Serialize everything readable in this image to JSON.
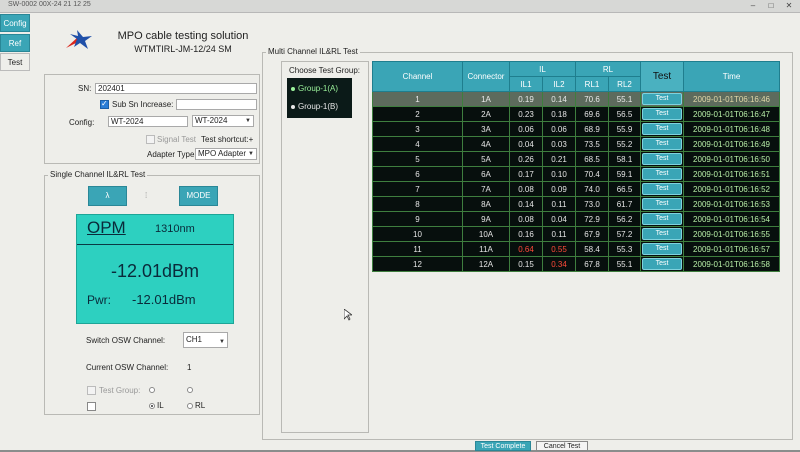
{
  "window": {
    "title": "SW-0002 00X-24 21 12 25"
  },
  "sidebar": {
    "tabs": [
      {
        "label": "Config"
      },
      {
        "label": "Ref"
      },
      {
        "label": "Test"
      }
    ]
  },
  "header": {
    "title": "MPO cable testing solution",
    "subtitle": "WTMTIRL-JM-12/24 SM"
  },
  "config": {
    "sn_label": "SN:",
    "sn_value": "202401",
    "sub_sn_label": "Sub Sn Increase:",
    "config_label": "Config:",
    "config_value1": "WT-2024",
    "config_value2": "WT-2024",
    "signal_test_label": "Signal Test",
    "test_shortcut_label": "Test shortcut:+",
    "adapter_type_label": "Adapter Type",
    "adapter_type_value": "MPO Adapter"
  },
  "single_channel": {
    "title": "Single Channel IL&RL Test",
    "lambda_button": "λ",
    "mode_button": "MODE",
    "opm_title": "OPM",
    "wavelength": "1310nm",
    "power_main": "-12.01dBm",
    "pwr_label": "Pwr:",
    "pwr_value": "-12.01dBm",
    "switch_osw_label": "Switch OSW Channel:",
    "switch_osw_value": "CH1",
    "current_osw_label": "Current OSW Channel:",
    "current_osw_value": "1",
    "test_group_label": "Test Group:",
    "il_label": "IL",
    "rl_label": "RL"
  },
  "multi_channel": {
    "title": "Multi Channel IL&RL Test",
    "choose_group_label": "Choose Test Group:",
    "groups": [
      {
        "label": "Group-1(A)"
      },
      {
        "label": "Group-1(B)"
      }
    ],
    "headers": {
      "channel": "Channel",
      "connector": "Connector",
      "il": "IL",
      "rl": "RL",
      "test": "Test",
      "time": "Time",
      "il1": "IL1",
      "il2": "IL2",
      "rl1": "RL1",
      "rl2": "RL2"
    },
    "rows": [
      {
        "channel": "1",
        "connector": "1A",
        "il1": "0.19",
        "il2": "0.14",
        "rl1": "70.6",
        "rl2": "55.1",
        "test": "Test",
        "time": "2009-01-01T06:16:46"
      },
      {
        "channel": "2",
        "connector": "2A",
        "il1": "0.23",
        "il2": "0.18",
        "rl1": "69.6",
        "rl2": "56.5",
        "test": "Test",
        "time": "2009-01-01T06:16:47"
      },
      {
        "channel": "3",
        "connector": "3A",
        "il1": "0.06",
        "il2": "0.06",
        "rl1": "68.9",
        "rl2": "55.9",
        "test": "Test",
        "time": "2009-01-01T06:16:48"
      },
      {
        "channel": "4",
        "connector": "4A",
        "il1": "0.04",
        "il2": "0.03",
        "rl1": "73.5",
        "rl2": "55.2",
        "test": "Test",
        "time": "2009-01-01T06:16:49"
      },
      {
        "channel": "5",
        "connector": "5A",
        "il1": "0.26",
        "il2": "0.21",
        "rl1": "68.5",
        "rl2": "58.1",
        "test": "Test",
        "time": "2009-01-01T06:16:50"
      },
      {
        "channel": "6",
        "connector": "6A",
        "il1": "0.17",
        "il2": "0.10",
        "rl1": "70.4",
        "rl2": "59.1",
        "test": "Test",
        "time": "2009-01-01T06:16:51"
      },
      {
        "channel": "7",
        "connector": "7A",
        "il1": "0.08",
        "il2": "0.09",
        "rl1": "74.0",
        "rl2": "66.5",
        "test": "Test",
        "time": "2009-01-01T06:16:52"
      },
      {
        "channel": "8",
        "connector": "8A",
        "il1": "0.14",
        "il2": "0.11",
        "rl1": "73.0",
        "rl2": "61.7",
        "test": "Test",
        "time": "2009-01-01T06:16:53"
      },
      {
        "channel": "9",
        "connector": "9A",
        "il1": "0.08",
        "il2": "0.04",
        "rl1": "72.9",
        "rl2": "56.2",
        "test": "Test",
        "time": "2009-01-01T06:16:54"
      },
      {
        "channel": "10",
        "connector": "10A",
        "il1": "0.16",
        "il2": "0.11",
        "rl1": "67.9",
        "rl2": "57.2",
        "test": "Test",
        "time": "2009-01-01T06:16:55"
      },
      {
        "channel": "11",
        "connector": "11A",
        "il1": "0.64",
        "il2": "0.55",
        "rl1": "58.4",
        "rl2": "55.3",
        "test": "Test",
        "time": "2009-01-01T06:16:57"
      },
      {
        "channel": "12",
        "connector": "12A",
        "il1": "0.15",
        "il2": "0.34",
        "rl1": "67.8",
        "rl2": "55.1",
        "test": "Test",
        "time": "2009-01-01T06:16:58"
      }
    ]
  },
  "footer": {
    "complete_button": "Test Complete",
    "cancel_button": "Cancel Test"
  },
  "colors": {
    "accent": "#3aa5b6",
    "opm_panel": "#2dd0c0",
    "table_bg": "#070f0d",
    "fail": "#ff4a3a"
  }
}
